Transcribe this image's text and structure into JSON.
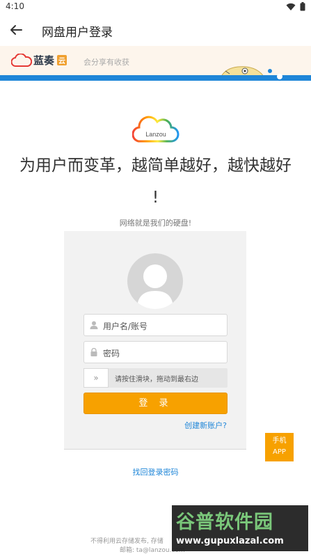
{
  "status": {
    "time": "4:10"
  },
  "appbar": {
    "title": "网盘用户登录"
  },
  "site_header": {
    "logo_text": "蓝奏",
    "logo_badge": "云",
    "slogan": "会分享有收获"
  },
  "hero": {
    "cloud_text": "Lanzou",
    "headline_line1": "为用户而变革，越简单越好，越快越好",
    "headline_line2": "!",
    "subline": "网络就是我们的硬盘!"
  },
  "login": {
    "username_placeholder": "用户名/账号",
    "password_placeholder": "密码",
    "slider_knob": "»",
    "slider_text": "请按住滑块，拖动到最右边",
    "login_button": "登 录",
    "register_link": "创建新账户?"
  },
  "app_button": {
    "line1": "手机",
    "line2": "APP"
  },
  "recover_link": "找回登录密码",
  "footer": {
    "line1": "不得利用云存储发布, 存储",
    "line2": "邮箱: ta@lanzou.com"
  },
  "watermark": {
    "title": "谷普软件园",
    "url": "www.gupuxlazal.com"
  },
  "colors": {
    "accent": "#f7a100",
    "link": "#1f86d8",
    "band": "#1f86d8"
  }
}
